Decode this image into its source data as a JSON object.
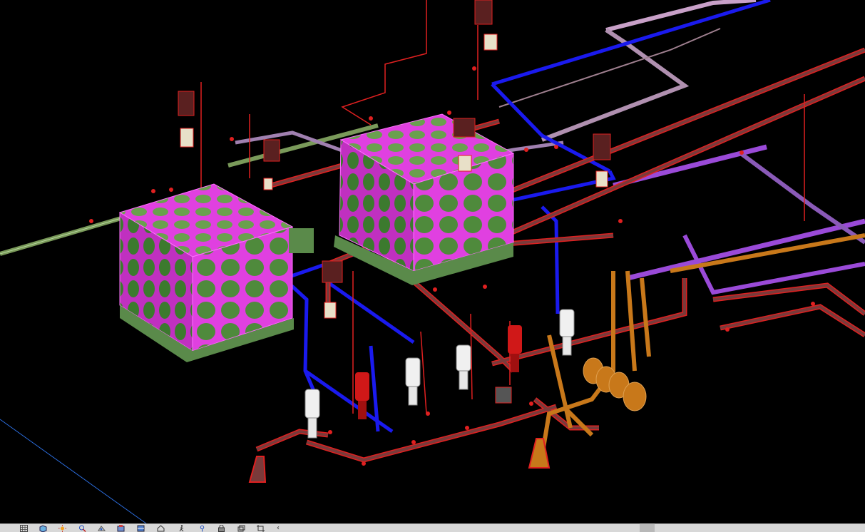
{
  "viewport": {
    "background": "#000000",
    "colors": {
      "tank_frame": "#e040e0",
      "tank_panel": "#4f8a3c",
      "tank_base": "#5a8a4a",
      "fire_pipe": "#7a3a3a",
      "fire_pipe_outline": "#e02020",
      "blue_pipe": "#1a1aee",
      "purple_pipe": "#9a4ad8",
      "green_pipe": "#7a9a5a",
      "orange_pipe": "#c8781a",
      "pump_white": "#f0f0f0",
      "pump_red": "#d01818"
    }
  },
  "statusbar": {
    "icons": [
      "grid-icon",
      "cube-icon",
      "sun-icon",
      "zoom-icon",
      "orbit-icon",
      "render-icon",
      "section-icon",
      "house-icon",
      "walk-icon",
      "pin-icon",
      "lock-icon",
      "layers-icon",
      "crop-icon",
      "collapse-icon"
    ],
    "collapse_glyph": "‹"
  }
}
